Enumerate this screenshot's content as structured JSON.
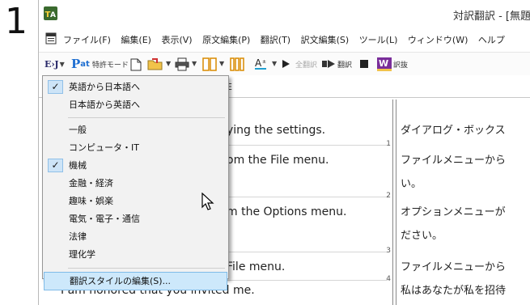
{
  "step_number": "1",
  "window": {
    "title": "対訳翻訳 - [無題",
    "app_icon": "tw-app-icon"
  },
  "menubar": {
    "items": [
      "ファイル(F)",
      "編集(E)",
      "表示(V)",
      "原文編集(P)",
      "翻訳(T)",
      "訳文編集(S)",
      "ツール(L)",
      "ウィンドウ(W)",
      "ヘルプ"
    ]
  },
  "toolbar": {
    "direction_button": "E›J",
    "mode_label": "特許モード",
    "translate_all": "全翻訳",
    "translate": "翻訳",
    "dictionary": "訳抜"
  },
  "dropdown": {
    "direction_items": [
      {
        "label": "英語から日本語へ",
        "checked": true
      },
      {
        "label": "日本語から英語へ",
        "checked": false
      }
    ],
    "field_items": [
      {
        "label": "一般",
        "checked": false
      },
      {
        "label": "コンピュータ・IT",
        "checked": false
      },
      {
        "label": "機械",
        "checked": true
      },
      {
        "label": "金融・経済",
        "checked": false
      },
      {
        "label": "趣味・娯楽",
        "checked": false
      },
      {
        "label": "電気・電子・通信",
        "checked": false
      },
      {
        "label": "法律",
        "checked": false
      },
      {
        "label": "理化学",
        "checked": false
      }
    ],
    "edit_style": "翻訳スタイルの編集(S)..."
  },
  "document": {
    "header_fragment": "E",
    "rows": [
      {
        "num": "1",
        "source": "ying the settings.",
        "target": [
          "ダイアログ・ボックス"
        ]
      },
      {
        "num": "2",
        "source": "om the File menu.",
        "target": [
          "ファイルメニューから",
          "い。"
        ]
      },
      {
        "num": "3",
        "source": "m the Options menu.",
        "target": [
          "オプションメニューが",
          "ださい。"
        ]
      },
      {
        "num": "4",
        "source": "File menu.",
        "target": [
          "ファイルメニューから"
        ]
      },
      {
        "num": "",
        "source": "I am honored that you invited me.",
        "target": [
          "私はあなたが私を招待"
        ]
      }
    ]
  },
  "colors": {
    "menu_bg": "#f2f2f2",
    "check_bg": "#cde4f7",
    "hover_bg": "#cde8fb",
    "accent_blue": "#1f6fd1"
  }
}
